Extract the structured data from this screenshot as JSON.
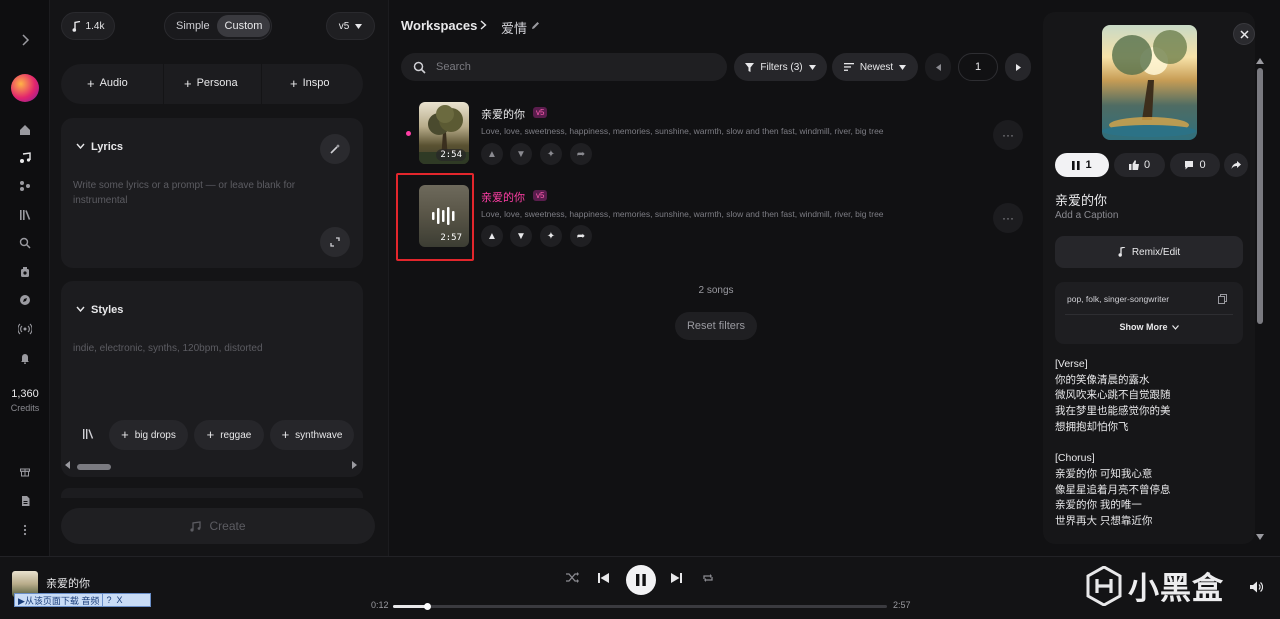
{
  "rail": {
    "credits_count": "1,360",
    "credits_label": "Credits"
  },
  "create": {
    "play_count": "1.4k",
    "mode_tabs": [
      "Simple",
      "Custom"
    ],
    "version": "v5",
    "add_buttons": [
      "Audio",
      "Persona",
      "Inspo"
    ],
    "lyrics_title": "Lyrics",
    "lyrics_placeholder": "Write some lyrics or a prompt — or leave blank for instrumental",
    "styles_title": "Styles",
    "styles_placeholder": "indie, electronic, synths, 120bpm, distorted",
    "style_chips": [
      "big drops",
      "reggae",
      "synthwave"
    ],
    "create_label": "Create"
  },
  "workspace": {
    "breadcrumb_root": "Workspaces",
    "breadcrumb_current": "爱情",
    "search_placeholder": "Search",
    "filters_label": "Filters (3)",
    "sort_label": "Newest",
    "page": "1",
    "songs": [
      {
        "title": "亲爱的你",
        "version": "v5",
        "tags": "Love, love, sweetness, happiness, memories, sunshine, warmth, slow and then fast, windmill, river, big tree",
        "duration": "2:54"
      },
      {
        "title": "亲爱的你",
        "version": "v5",
        "tags": "Love, love, sweetness, happiness, memories, sunshine, warmth, slow and then fast, windmill, river, big tree",
        "duration": "2:57"
      }
    ],
    "song_count": "2 songs",
    "reset_label": "Reset filters"
  },
  "detail": {
    "play_count": "1",
    "like_count": "0",
    "comment_count": "0",
    "title": "亲爱的你",
    "caption_placeholder": "Add a Caption",
    "remix_label": "Remix/Edit",
    "style_text": "pop, folk, singer-songwriter",
    "show_more": "Show More",
    "lyrics": [
      "[Verse]",
      "你的笑像清晨的露水",
      "微风吹来心跳不自觉跟随",
      "我在梦里也能感觉你的美",
      "想拥抱却怕你飞",
      "",
      "[Chorus]",
      "亲爱的你 可知我心意",
      "像星星追着月亮不曾停息",
      "亲爱的你 我的唯一",
      "世界再大 只想靠近你"
    ]
  },
  "player": {
    "title": "亲爱的你",
    "elapsed": "0:12",
    "total": "2:57",
    "progress_fraction": 0.068,
    "download_label": "▶从该页面下载 音频",
    "download_help": "?",
    "download_close": "X",
    "watermark": "小黑盒"
  },
  "colors": {
    "accent": "#ff3ea5",
    "highlight_box": "#e3262c",
    "badge_bg": "#5a1d4d"
  }
}
